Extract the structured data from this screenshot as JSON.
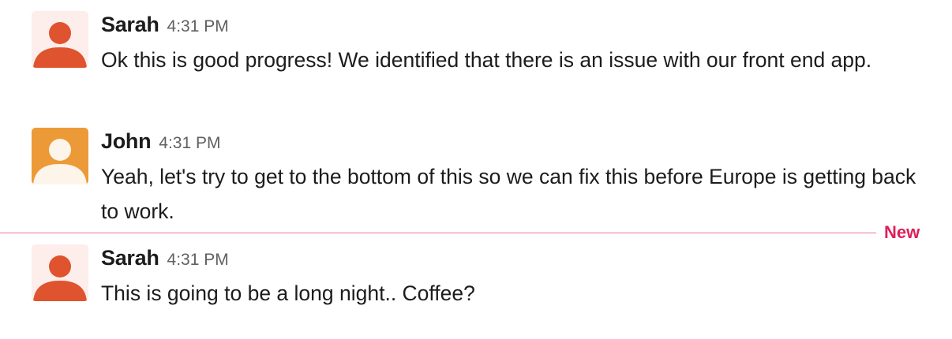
{
  "messages": [
    {
      "sender": "Sarah",
      "time": "4:31 PM",
      "text": "Ok this is good progress! We identified that there is an issue with our front end app.",
      "avatar": {
        "icon": "person-icon",
        "background": "#fdeeeb",
        "figure": "#e0532f"
      }
    },
    {
      "sender": "John",
      "time": "4:31 PM",
      "text": "Yeah, let's try to get to the bottom of this so we can fix this before Europe is getting back to work.",
      "avatar": {
        "icon": "person-icon",
        "background": "#ec9a37",
        "figure": "#fdf4ea"
      }
    },
    {
      "sender": "Sarah",
      "time": "4:31 PM",
      "text": "This is going to be a long night.. Coffee?",
      "avatar": {
        "icon": "person-icon",
        "background": "#fdeeeb",
        "figure": "#e0532f"
      }
    }
  ],
  "new_divider": {
    "label": "New",
    "line_color": "#e8789e",
    "label_color": "#e01e5a"
  }
}
